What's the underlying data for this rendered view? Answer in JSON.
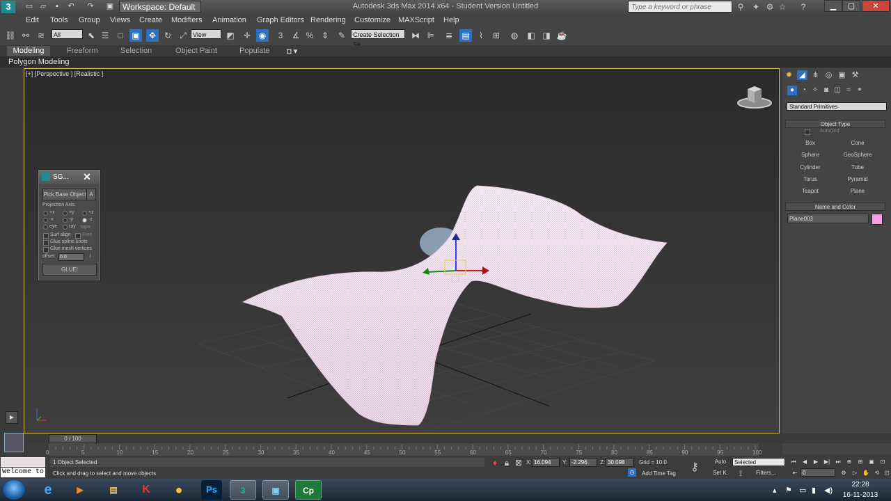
{
  "app": {
    "title": "Autodesk 3ds Max  2014 x64  -  Student Version    Untitled",
    "workspace": "Workspace: Default",
    "search_placeholder": "Type a keyword or phrase",
    "logo_glyph": "3"
  },
  "menu": [
    "Edit",
    "Tools",
    "Group",
    "Views",
    "Create",
    "Modifiers",
    "Animation",
    "Graph Editors",
    "Rendering",
    "Customize",
    "MAXScript",
    "Help"
  ],
  "toolbar": {
    "selection_filter": "All",
    "ref_coord": "View",
    "named_selection": "Create Selection Se"
  },
  "ribbon": {
    "tabs": [
      "Modeling",
      "Freeform",
      "Selection",
      "Object Paint",
      "Populate"
    ],
    "panel_label": "Polygon Modeling"
  },
  "viewport": {
    "label": "[+] [Perspective ] [Realistic ]",
    "mesh_color": "#f3e4f1"
  },
  "sg_dialog": {
    "title": "SG...",
    "close_glyph": "✕",
    "pick_label": "Pick Base Object",
    "a_label": "A",
    "projection_label": "Projection Axis:",
    "axes": [
      "+x",
      "+y",
      "+z",
      "-x",
      "-y",
      "-z"
    ],
    "eye": "eye",
    "ray": "ray",
    "tape": "tape",
    "surf_align": "Surf align",
    "free": "Free",
    "glue_knots": "Glue spline knots",
    "glue_verts": "Glue mesh vertices",
    "offset_label": "offset:",
    "offset_value": "0.0",
    "i_label": "i",
    "glue_button": "GLUE!"
  },
  "command_panel": {
    "category": "Standard Primitives",
    "object_type_header": "Object Type",
    "autogrid": "AutoGrid",
    "primitives": [
      "Box",
      "Cone",
      "Sphere",
      "GeoSphere",
      "Cylinder",
      "Tube",
      "Torus",
      "Pyramid",
      "Teapot",
      "Plane"
    ],
    "name_color_header": "Name and Color",
    "object_name": "Plane003",
    "object_color": "#f2a0e0"
  },
  "timeline": {
    "slider": "0 / 100",
    "ticks": [
      "0",
      "5",
      "10",
      "15",
      "20",
      "25",
      "30",
      "35",
      "40",
      "45",
      "50",
      "55",
      "60",
      "65",
      "70",
      "75",
      "80",
      "85",
      "90",
      "95",
      "100"
    ]
  },
  "status": {
    "listener_text": "Welcome to",
    "selection": "1 Object Selected",
    "prompt": "Click and drag to select and move objects",
    "x_label": "X:",
    "x_value": "16.094",
    "y_label": "Y:",
    "y_value": "-2.296",
    "z_label": "Z:",
    "z_value": "30.098",
    "grid": "Grid = 10.0",
    "add_time_tag": "Add Time Tag",
    "auto_key": "Auto",
    "set_key": "Set K.",
    "key_filter": "Selected",
    "filters": "Filters...",
    "frame": "0"
  },
  "taskbar": {
    "apps": [
      "e",
      "▶",
      "▤",
      "K",
      "●",
      "Ps",
      "3",
      "▣",
      "Cp"
    ],
    "time": "22:28",
    "date": "16-11-2013"
  }
}
